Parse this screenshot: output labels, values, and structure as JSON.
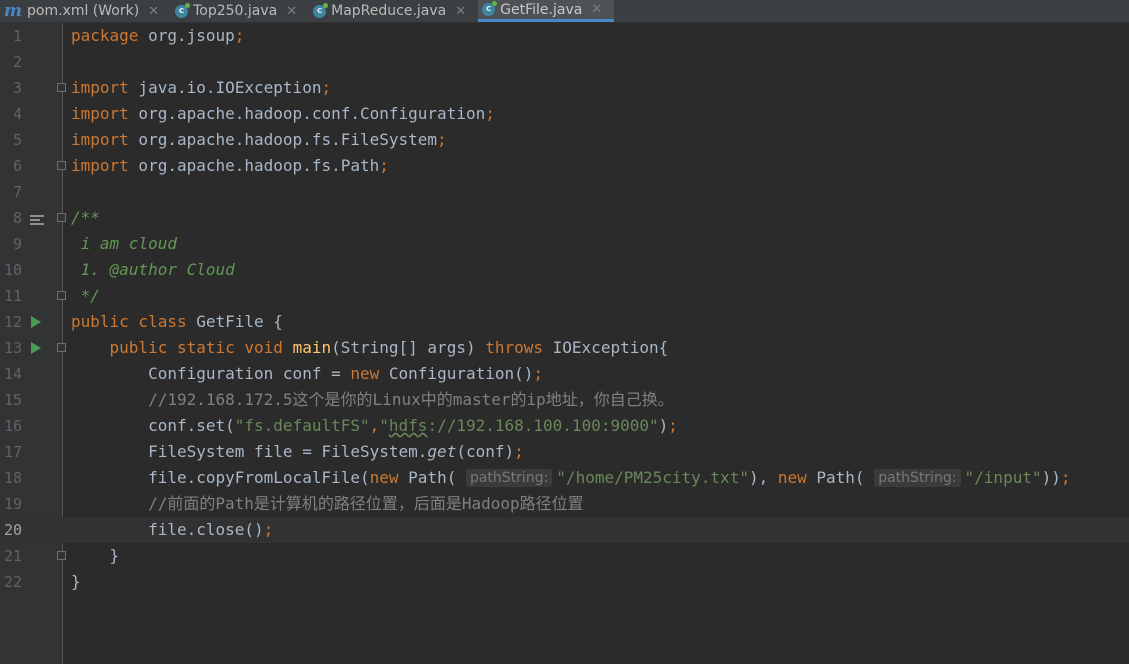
{
  "tabs": [
    {
      "label": "pom.xml (Work)",
      "icon": "maven-icon",
      "active": false
    },
    {
      "label": "Top250.java",
      "icon": "java-class-icon",
      "active": false
    },
    {
      "label": "MapReduce.java",
      "icon": "java-class-icon",
      "active": false
    },
    {
      "label": "GetFile.java",
      "icon": "java-class-icon",
      "active": true
    }
  ],
  "close_glyph": "✕",
  "line_numbers": [
    "1",
    "2",
    "3",
    "4",
    "5",
    "6",
    "7",
    "8",
    "9",
    "10",
    "11",
    "12",
    "13",
    "14",
    "15",
    "16",
    "17",
    "18",
    "19",
    "20",
    "21",
    "22"
  ],
  "current_line": "20",
  "code": {
    "l1_kw": "package",
    "l1_rest": " org.jsoup",
    "semi": ";",
    "import_kw": "import",
    "l3": " java.io.IOException",
    "l4": " org.apache.hadoop.conf.Configuration",
    "l5": " org.apache.hadoop.fs.FileSystem",
    "l6": " org.apache.hadoop.fs.Path",
    "l8": "/**",
    "l9": " i am cloud",
    "l10_pre": " 1. ",
    "l10_tag": "@author",
    "l10_rest": " Cloud",
    "l11": " */",
    "l12_kw": "public class",
    "l12_rest": " GetFile {",
    "l13_kw1": "public static void",
    "l13_fn": "main",
    "l13_mid": "(String[] args) ",
    "l13_kw2": "throws",
    "l13_rest": " IOException{",
    "l14_pre": "Configuration conf = ",
    "new_kw": "new",
    "l14_post": " Configuration()",
    "l15": "//192.168.172.5这个是你的Linux中的master的ip地址，你自己换。",
    "l16_pre": "conf.set(",
    "l16_s1": "\"fs.defaultFS\"",
    "comma": ",",
    "l16_s2a": "\"",
    "l16_s2b": "hdfs",
    "l16_s2c": "://192.168.100.100:9000\"",
    "l16_post": ")",
    "l17_pre": "FileSystem file = FileSystem.",
    "l17_get": "get",
    "l17_post": "(conf)",
    "l18_pre": "file.copyFromLocalFile(",
    "l18_path": " Path(",
    "hint": "pathString:",
    "l18_s1": "\"/home/PM25city.txt\"",
    "l18_mid": "), ",
    "l18_s2": "\"/input\"",
    "l18_post": "))",
    "l19": "//前面的Path是计算机的路径位置，后面是Hadoop路径位置",
    "l20": "file.close()",
    "l21": "}",
    "l22": "}"
  }
}
